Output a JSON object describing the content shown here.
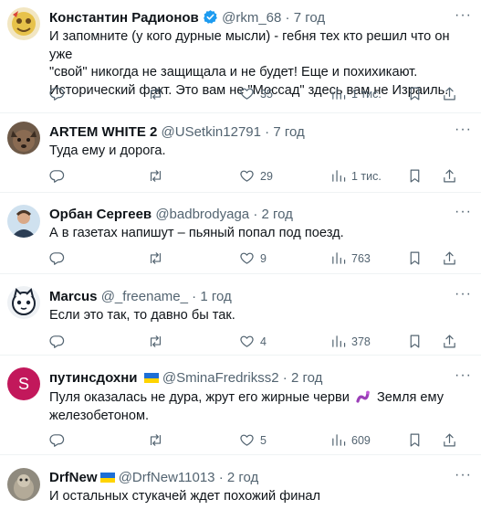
{
  "tweets": [
    {
      "name": "Константин Радионов",
      "verified": true,
      "handle": "@rkm_68",
      "sep": "·",
      "time": "7 год",
      "lines": [
        "И запомните (у кого дурные мысли) - гебня тех кто решил что он уже",
        "\"свой\" никогда не защищала и не будет! Еще и похихикают.",
        "Исторический факт. Это вам не \"Моссад\" здесь вам не Израиль."
      ],
      "reply_count": "",
      "retweet_count": "",
      "like_count": "35",
      "views_count": "1 тис."
    },
    {
      "name": "ARTEM WHITE 2",
      "handle": "@USetkin12791",
      "sep": "·",
      "time": "7 год",
      "lines": [
        "Туда ему и дорога."
      ],
      "reply_count": "",
      "retweet_count": "",
      "like_count": "29",
      "views_count": "1 тис."
    },
    {
      "name": "Орбан Сергеев",
      "handle": "@badbrodyaga",
      "sep": "·",
      "time": "2 год",
      "lines": [
        "А в газетах напишут – пьяный попал под поезд."
      ],
      "reply_count": "",
      "retweet_count": "",
      "like_count": "9",
      "views_count": "763"
    },
    {
      "name": "Marcus",
      "handle": "@_freename_",
      "sep": "·",
      "time": "1 год",
      "lines": [
        "Если это так, то давно бы так."
      ],
      "reply_count": "",
      "retweet_count": "",
      "like_count": "4",
      "views_count": "378"
    },
    {
      "name": "путинсдохни",
      "flag": "ukraine-flag",
      "handle": "@SminaFredrikss2",
      "sep": "·",
      "time": "2 год",
      "line1_before": "Пуля оказалась не дура, жрут его жирные черви",
      "line1_after": "Земля ему",
      "line2": "железобетоном.",
      "emoji": "worm-emoji",
      "avatar_letter": "S",
      "reply_count": "",
      "retweet_count": "",
      "like_count": "5",
      "views_count": "609"
    },
    {
      "name": "DrfNew",
      "flag": "ukraine-flag",
      "handle": "@DrfNew11013",
      "sep": "·",
      "time": "2 год",
      "lines": [
        "И остальных стукачей ждет похожий финал"
      ]
    }
  ],
  "icons": {
    "reply": "reply-icon",
    "retweet": "retweet-icon",
    "like": "heart-icon",
    "views": "views-icon",
    "bookmark": "bookmark-icon",
    "share": "share-icon",
    "more": "more-icon",
    "verified": "verified-icon"
  },
  "more_label": "···",
  "colors": {
    "secondary_text": "#536471",
    "verified": "#1d9bf0",
    "divider": "#eff3f4",
    "avatar_s": "#c2185b"
  }
}
